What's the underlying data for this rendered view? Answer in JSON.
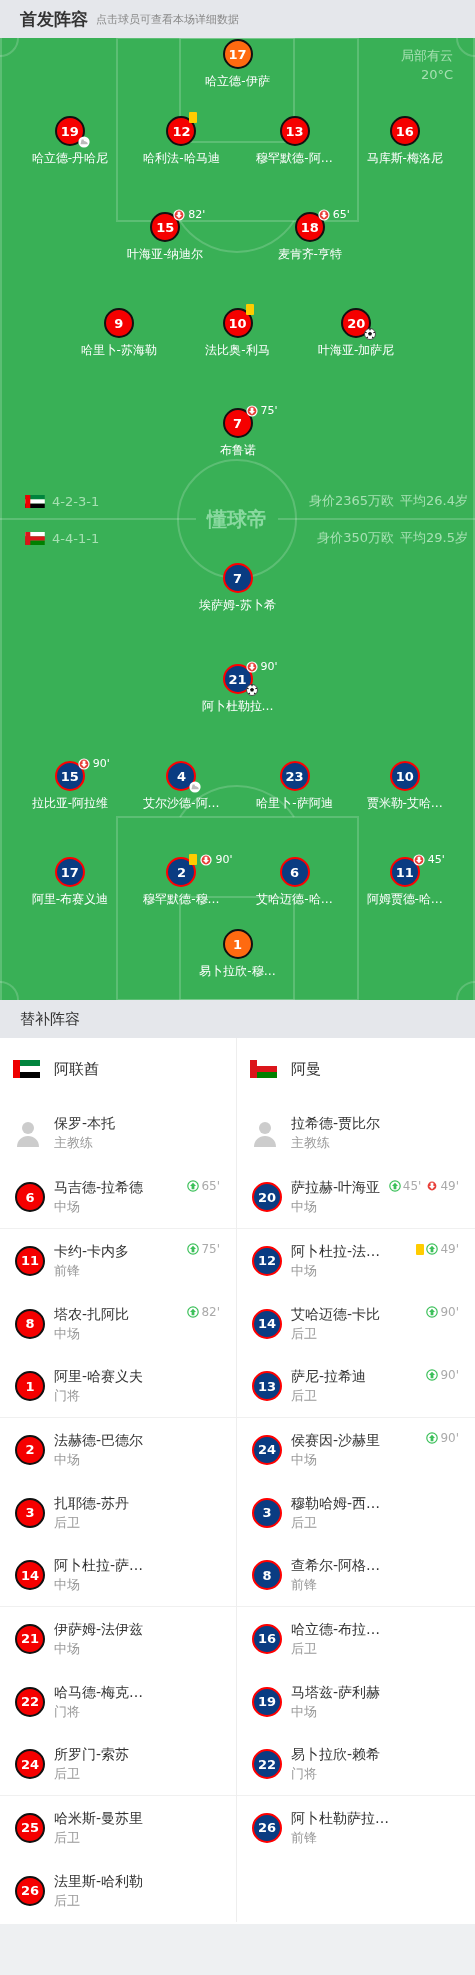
{
  "header": {
    "title": "首发阵容",
    "hint": "点击球员可查看本场详细数据"
  },
  "pitch": {
    "weather": {
      "condition": "局部有云",
      "temperature": "20°C"
    },
    "logo": "懂球帝",
    "teams": [
      {
        "kind": "home",
        "formation": "4-2-3-1",
        "value": "身价2365万欧",
        "average_age": "平均26.4岁",
        "lines": [
          [
            {
              "number": "17",
              "name": "哈立德-伊萨",
              "kind": "goalkeeper"
            }
          ],
          [
            {
              "number": "19",
              "name": "哈立德-丹哈尼",
              "kind": "outfield",
              "events": [
                {
                  "kind": "assist"
                }
              ]
            },
            {
              "number": "12",
              "name": "哈利法-哈马迪",
              "kind": "outfield",
              "events": [
                {
                  "kind": "yellow_card"
                }
              ]
            },
            {
              "number": "13",
              "name": "穆罕默德-阿…",
              "kind": "outfield"
            },
            {
              "number": "16",
              "name": "马库斯-梅洛尼",
              "kind": "outfield"
            }
          ],
          [
            {
              "number": "15",
              "name": "叶海亚-纳迪尔",
              "kind": "outfield",
              "events": [
                {
                  "kind": "sub_out",
                  "minute": "82'"
                }
              ]
            },
            {
              "number": "18",
              "name": "麦肯齐-亨特",
              "kind": "outfield",
              "events": [
                {
                  "kind": "sub_out",
                  "minute": "65'"
                }
              ]
            }
          ],
          [
            {
              "number": "9",
              "name": "哈里卜-苏海勒",
              "kind": "outfield"
            },
            {
              "number": "10",
              "name": "法比奥-利马",
              "kind": "outfield",
              "events": [
                {
                  "kind": "yellow_card"
                }
              ]
            },
            {
              "number": "20",
              "name": "叶海亚-加萨尼",
              "kind": "outfield",
              "events": [
                {
                  "kind": "goal"
                }
              ]
            }
          ],
          [
            {
              "number": "7",
              "name": "布鲁诺",
              "kind": "outfield",
              "events": [
                {
                  "kind": "sub_out",
                  "minute": "75'"
                }
              ]
            }
          ]
        ]
      },
      {
        "kind": "away",
        "formation": "4-4-1-1",
        "value": "身价350万欧",
        "average_age": "平均29.5岁",
        "lines": [
          [
            {
              "number": "7",
              "name": "埃萨姆-苏卜希",
              "kind": "outfield"
            }
          ],
          [
            {
              "number": "21",
              "name": "阿卜杜勒拉…",
              "kind": "outfield",
              "events": [
                {
                  "kind": "sub_out",
                  "minute": "90'"
                },
                {
                  "kind": "goal"
                }
              ]
            }
          ],
          [
            {
              "number": "15",
              "name": "拉比亚-阿拉维",
              "kind": "outfield",
              "events": [
                {
                  "kind": "sub_out",
                  "minute": "90'"
                }
              ]
            },
            {
              "number": "4",
              "name": "艾尔沙德-阿…",
              "kind": "outfield",
              "events": [
                {
                  "kind": "assist"
                }
              ]
            },
            {
              "number": "23",
              "name": "哈里卜-萨阿迪",
              "kind": "outfield"
            },
            {
              "number": "10",
              "name": "贾米勒-艾哈…",
              "kind": "outfield"
            }
          ],
          [
            {
              "number": "17",
              "name": "阿里-布赛义迪",
              "kind": "outfield"
            },
            {
              "number": "2",
              "name": "穆罕默德-穆…",
              "kind": "outfield",
              "events": [
                {
                  "kind": "yellow_card"
                },
                {
                  "kind": "sub_out",
                  "minute": "90'"
                }
              ]
            },
            {
              "number": "6",
              "name": "艾哈迈德-哈…",
              "kind": "outfield"
            },
            {
              "number": "11",
              "name": "阿姆贾德-哈…",
              "kind": "outfield",
              "events": [
                {
                  "kind": "sub_out",
                  "minute": "45'"
                }
              ]
            }
          ],
          [
            {
              "number": "1",
              "name": "易卜拉欣-穆…",
              "kind": "goalkeeper"
            }
          ]
        ]
      }
    ]
  },
  "substitutes": {
    "title": "替补阵容",
    "teams": [
      {
        "kind": "home",
        "name": "阿联酋",
        "coach": {
          "name": "保罗-本托",
          "role": "主教练"
        },
        "bench": [
          {
            "number": "6",
            "name": "马吉德-拉希德",
            "position": "中场",
            "events": [
              {
                "kind": "sub_in",
                "minute": "65'"
              }
            ]
          },
          {
            "number": "11",
            "name": "卡约-卡内多",
            "position": "前锋",
            "events": [
              {
                "kind": "sub_in",
                "minute": "75'"
              }
            ]
          },
          {
            "number": "8",
            "name": "塔农-扎阿比",
            "position": "中场",
            "events": [
              {
                "kind": "sub_in",
                "minute": "82'"
              }
            ]
          },
          {
            "number": "1",
            "name": "阿里-哈赛义夫",
            "position": "门将"
          },
          {
            "number": "2",
            "name": "法赫德-巴德尔",
            "position": "中场"
          },
          {
            "number": "3",
            "name": "扎耶德-苏丹",
            "position": "后卫"
          },
          {
            "number": "14",
            "name": "阿卜杜拉-萨…",
            "position": "中场"
          },
          {
            "number": "21",
            "name": "伊萨姆-法伊兹",
            "position": "中场"
          },
          {
            "number": "22",
            "name": "哈马德-梅克…",
            "position": "门将"
          },
          {
            "number": "24",
            "name": "所罗门-索苏",
            "position": "后卫"
          },
          {
            "number": "25",
            "name": "哈米斯-曼苏里",
            "position": "后卫"
          },
          {
            "number": "26",
            "name": "法里斯-哈利勒",
            "position": "后卫"
          }
        ]
      },
      {
        "kind": "away",
        "name": "阿曼",
        "coach": {
          "name": "拉希德-贾比尔",
          "role": "主教练"
        },
        "bench": [
          {
            "number": "20",
            "name": "萨拉赫-叶海亚",
            "position": "中场",
            "events": [
              {
                "kind": "sub_in",
                "minute": "45'"
              },
              {
                "kind": "sub_out",
                "minute": "49'"
              }
            ]
          },
          {
            "number": "12",
            "name": "阿卜杜拉-法…",
            "position": "中场",
            "events": [
              {
                "kind": "yellow_card"
              },
              {
                "kind": "sub_in",
                "minute": "49'"
              }
            ]
          },
          {
            "number": "14",
            "name": "艾哈迈德-卡比",
            "position": "后卫",
            "events": [
              {
                "kind": "sub_in",
                "minute": "90'"
              }
            ]
          },
          {
            "number": "13",
            "name": "萨尼-拉希迪",
            "position": "后卫",
            "events": [
              {
                "kind": "sub_in",
                "minute": "90'"
              }
            ]
          },
          {
            "number": "24",
            "name": "侯赛因-沙赫里",
            "position": "中场",
            "events": [
              {
                "kind": "sub_in",
                "minute": "90'"
              }
            ]
          },
          {
            "number": "3",
            "name": "穆勒哈姆-西…",
            "position": "后卫"
          },
          {
            "number": "8",
            "name": "查希尔-阿格…",
            "position": "前锋"
          },
          {
            "number": "16",
            "name": "哈立德-布拉…",
            "position": "后卫"
          },
          {
            "number": "19",
            "name": "马塔兹-萨利赫",
            "position": "中场"
          },
          {
            "number": "22",
            "name": "易卜拉欣-赖希",
            "position": "门将"
          },
          {
            "number": "26",
            "name": "阿卜杜勒萨拉…",
            "position": "前锋"
          }
        ]
      }
    ]
  }
}
